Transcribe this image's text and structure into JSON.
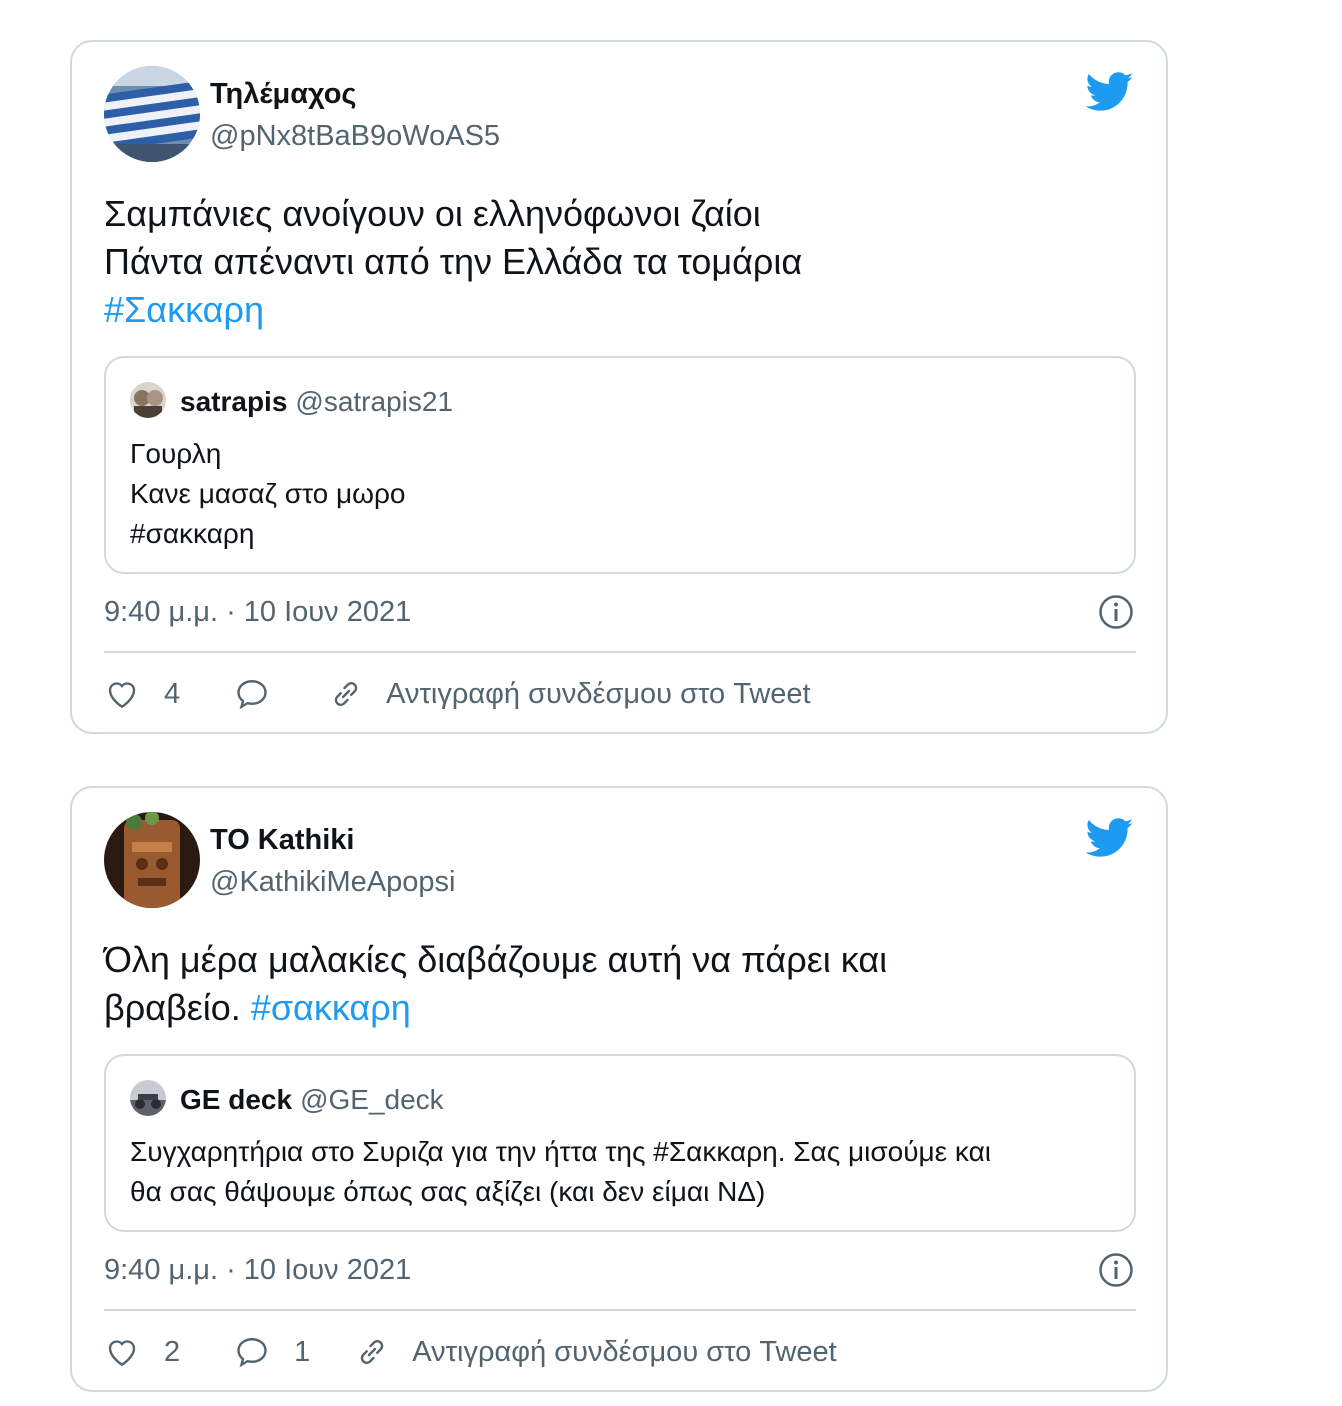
{
  "tweets": [
    {
      "name": "Τηλέμαχος",
      "handle": "@pNx8tBaB9oWoAS5",
      "text_lines": [
        "Σαμπάνιες ανοίγουν οι ελληνόφωνοι ζαίοι",
        "Πάντα απέναντι από την Ελλάδα τα τομάρια"
      ],
      "hashtag": "#Σακκαρη",
      "quote": {
        "name": "satrapis",
        "handle": "@satrapis21",
        "lines": [
          "Γουρλη",
          "Κανε μασαζ στο μωρο",
          "#σακκαρη"
        ]
      },
      "timestamp": "9:40 μ.μ. · 10 Ιουν 2021",
      "likes": "4",
      "replies": "",
      "copy_link": "Αντιγραφή συνδέσμου στο Tweet"
    },
    {
      "name": "TO Kathiki",
      "handle": "@KathikiMeApopsi",
      "text_line1": "Όλη μέρα μαλακίες διαβάζουμε αυτή να πάρει και",
      "text_line2": "βραβείο.",
      "hashtag": "#σακκαρη",
      "quote": {
        "name": "GE deck",
        "handle": "@GE_deck",
        "lines": [
          "Συγχαρητήρια στο Συριζα για την ήττα της #Σακκαρη. Σας μισούμε και",
          "θα σας θάψουμε όπως σας αξίζει (και δεν είμαι ΝΔ)"
        ]
      },
      "timestamp": "9:40 μ.μ. · 10 Ιουν 2021",
      "likes": "2",
      "replies": "1",
      "copy_link": "Αντιγραφή συνδέσμου στο Tweet"
    }
  ],
  "icons": {
    "brand": "twitter-bird-icon",
    "info": "info-icon",
    "like": "heart-icon",
    "reply": "reply-bubble-icon",
    "link": "link-icon"
  },
  "colors": {
    "twitter_blue": "#1d9bf0",
    "text": "#0f1419",
    "secondary": "#536471",
    "border": "#cfd9de"
  }
}
